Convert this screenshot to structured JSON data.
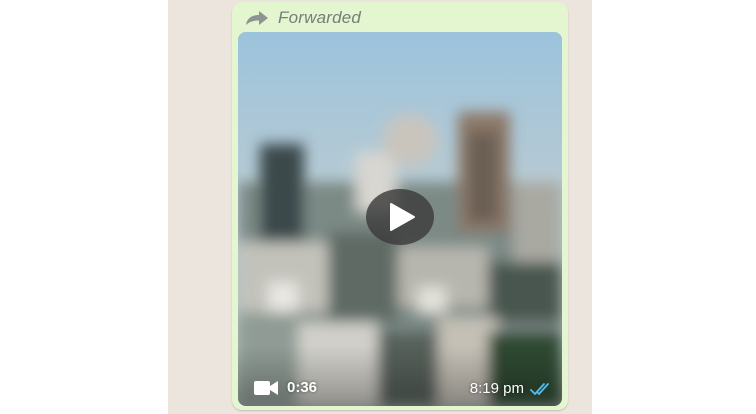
{
  "message": {
    "forwarded_label": "Forwarded",
    "video": {
      "duration": "0:36",
      "sent_time": "8:19 pm",
      "status": "read",
      "play_icon": "play-icon",
      "camera_icon": "video-camera-icon",
      "status_icon": "double-check-icon"
    },
    "colors": {
      "bubble": "#e3f6cf",
      "forwarded_text": "#777d7a",
      "read_ticks": "#53bdeb",
      "chat_background": "#ece5dd"
    }
  }
}
